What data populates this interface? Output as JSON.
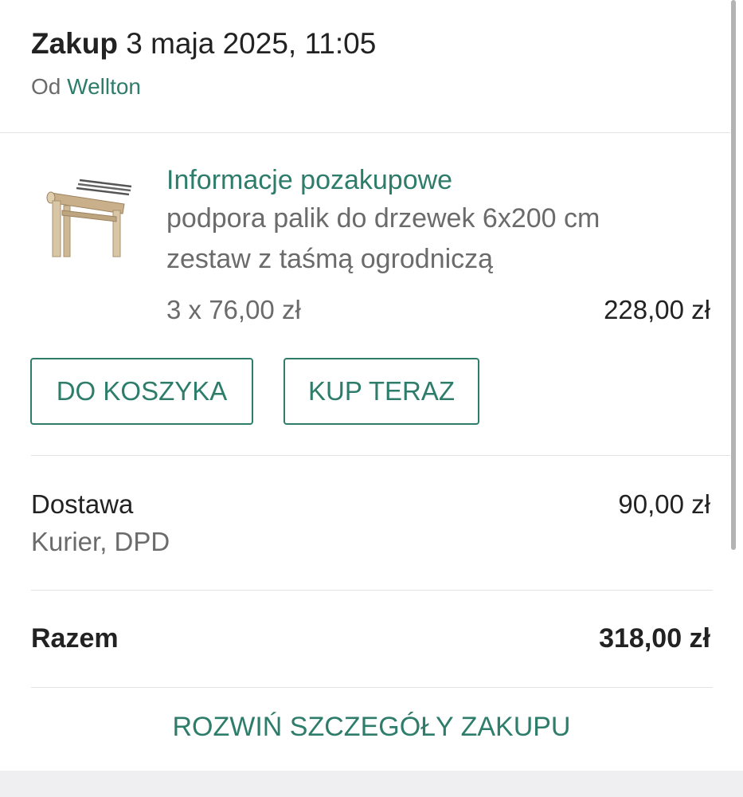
{
  "header": {
    "title_word": "Zakup",
    "date": "3 maja 2025, 11:05",
    "seller_prefix": "Od",
    "seller_name": "Wellton"
  },
  "product": {
    "section_link": "Informacje pozakupowe",
    "name_line1": "podpora palik do drzewek 6x200 cm",
    "name_line2": "zestaw z taśmą ogrodniczą",
    "quantity_price": "3 x 76,00 zł",
    "total": "228,00 zł",
    "image_icon": "wooden-tree-stake-kit-image"
  },
  "actions": {
    "add_to_cart": "DO KOSZYKA",
    "buy_now": "KUP TERAZ"
  },
  "delivery": {
    "label": "Dostawa",
    "method": "Kurier, DPD",
    "price": "90,00 zł"
  },
  "summary": {
    "total_label": "Razem",
    "total_amount": "318,00 zł"
  },
  "expand_link": "ROZWIŃ SZCZEGÓŁY ZAKUPU",
  "colors": {
    "accent": "#2e7d6b",
    "text": "#222222",
    "muted": "#6b6b6b",
    "divider": "#e3e3e3"
  }
}
